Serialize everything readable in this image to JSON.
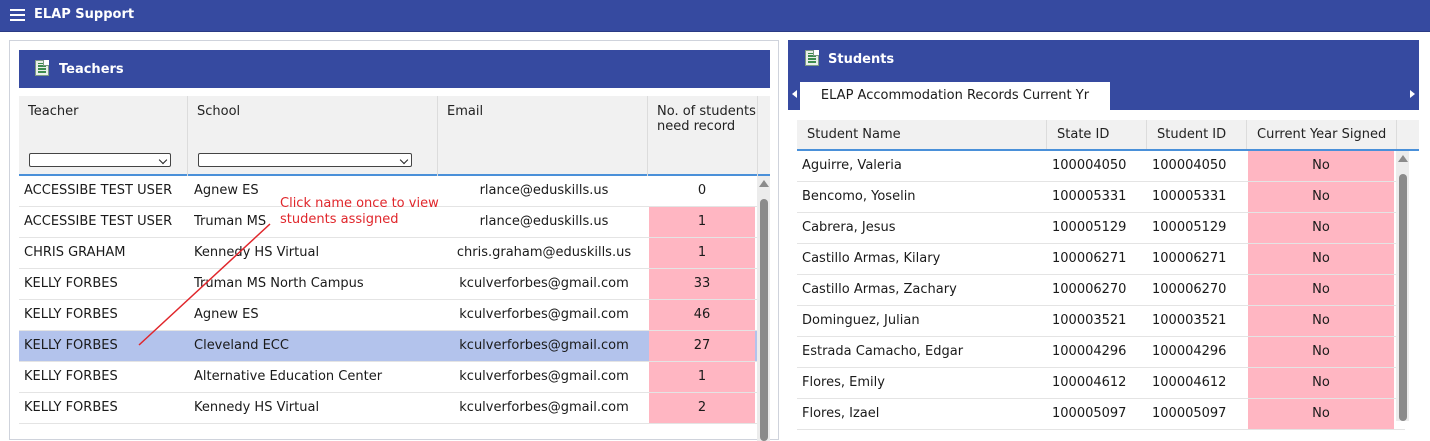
{
  "app": {
    "title": "ELAP Support"
  },
  "teachers": {
    "title": "Teachers",
    "columns": {
      "teacher": "Teacher",
      "school": "School",
      "email": "Email",
      "count_line1": "No. of students",
      "count_line2": "need record"
    },
    "rows": [
      {
        "teacher": "ACCESSIBE TEST USER",
        "school": "Agnew ES",
        "email": "rlance@eduskills.us",
        "count": "0"
      },
      {
        "teacher": "ACCESSIBE TEST USER",
        "school": "Truman MS",
        "email": "rlance@eduskills.us",
        "count": "1"
      },
      {
        "teacher": "CHRIS GRAHAM",
        "school": "Kennedy HS Virtual",
        "email": "chris.graham@eduskills.us",
        "count": "1"
      },
      {
        "teacher": "KELLY FORBES",
        "school": "Truman MS North Campus",
        "email": "kculverforbes@gmail.com",
        "count": "33"
      },
      {
        "teacher": "KELLY FORBES",
        "school": "Agnew ES",
        "email": "kculverforbes@gmail.com",
        "count": "46"
      },
      {
        "teacher": "KELLY FORBES",
        "school": "Cleveland ECC",
        "email": "kculverforbes@gmail.com",
        "count": "27"
      },
      {
        "teacher": "KELLY FORBES",
        "school": "Alternative Education Center",
        "email": "kculverforbes@gmail.com",
        "count": "1"
      },
      {
        "teacher": "KELLY FORBES",
        "school": "Kennedy HS Virtual",
        "email": "kculverforbes@gmail.com",
        "count": "2"
      }
    ],
    "annotation_line1": "Click name once to view",
    "annotation_line2": "students assigned"
  },
  "students": {
    "title": "Students",
    "tab_label": "ELAP Accommodation Records Current Yr",
    "columns": {
      "name": "Student Name",
      "state_id": "State ID",
      "student_id": "Student ID",
      "signed": "Current Year Signed"
    },
    "rows": [
      {
        "name": "Aguirre, Valeria",
        "state_id": "100004050",
        "student_id": "100004050",
        "signed": "No"
      },
      {
        "name": "Bencomo, Yoselin",
        "state_id": "100005331",
        "student_id": "100005331",
        "signed": "No"
      },
      {
        "name": "Cabrera, Jesus",
        "state_id": "100005129",
        "student_id": "100005129",
        "signed": "No"
      },
      {
        "name": "Castillo Armas, Kilary",
        "state_id": "100006271",
        "student_id": "100006271",
        "signed": "No"
      },
      {
        "name": "Castillo Armas, Zachary",
        "state_id": "100006270",
        "student_id": "100006270",
        "signed": "No"
      },
      {
        "name": "Dominguez, Julian",
        "state_id": "100003521",
        "student_id": "100003521",
        "signed": "No"
      },
      {
        "name": "Estrada Camacho, Edgar",
        "state_id": "100004296",
        "student_id": "100004296",
        "signed": "No"
      },
      {
        "name": "Flores, Emily",
        "state_id": "100004612",
        "student_id": "100004612",
        "signed": "No"
      },
      {
        "name": "Flores, Izael",
        "state_id": "100005097",
        "student_id": "100005097",
        "signed": "No"
      }
    ]
  },
  "colors": {
    "header_blue": "#364aa0",
    "selected_row": "#b3c3ec",
    "needs_record_pink": "#ffb6c2",
    "annotation_red": "#e0262b"
  }
}
